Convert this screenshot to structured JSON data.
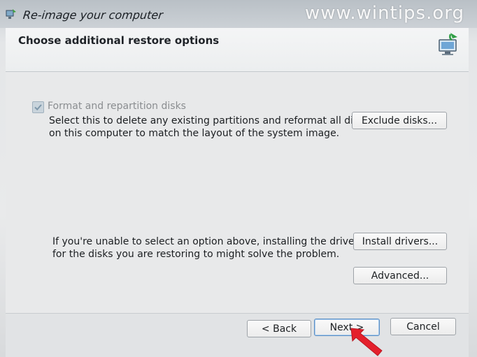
{
  "window": {
    "title": "Re-image your computer",
    "watermark": "www.wintips.org"
  },
  "header": {
    "title": "Choose additional restore options"
  },
  "format_option": {
    "checkbox_label": "Format and repartition disks",
    "checked": true,
    "description_line1": "Select this to delete any existing partitions and reformat all disks",
    "description_line2": "on this computer to match the layout of the system image.",
    "exclude_button": "Exclude disks..."
  },
  "drivers_section": {
    "description_line1": "If you're unable to select an option above, installing the drivers",
    "description_line2": "for the disks you are restoring to might solve the problem.",
    "install_button": "Install drivers...",
    "advanced_button": "Advanced..."
  },
  "footer": {
    "back_button": "< Back",
    "next_button": "Next >",
    "cancel_button": "Cancel"
  },
  "icons": {
    "app": "computer-restore-icon",
    "header": "system-image-restore-icon",
    "checkbox": "checkmark-icon",
    "pointer": "red-arrow-icon"
  },
  "colors": {
    "accent_arrow": "#e4202c",
    "next_focus_border": "#5c8fc4"
  }
}
